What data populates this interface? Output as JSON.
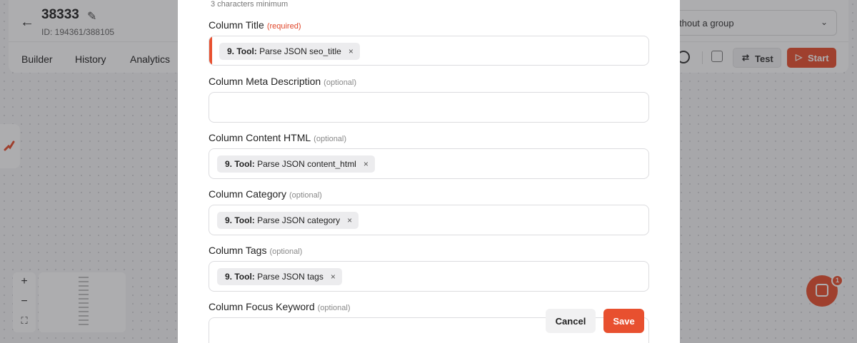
{
  "app": {
    "workflow_title": "38333",
    "workflow_id": "ID: 194361/388105",
    "tabs": [
      "Builder",
      "History",
      "Analytics"
    ],
    "group_select_value": "thout a group",
    "test_label": "Test",
    "start_label": "Start",
    "zoom_in": "+",
    "zoom_out": "−",
    "fit": "⛶",
    "chat_badge": "1"
  },
  "modal": {
    "hint": "3 characters minimum",
    "fields": [
      {
        "label": "Column Title",
        "tag": "(required)",
        "chip_prefix": "9. Tool:",
        "chip_text": "Parse JSON seo_title"
      },
      {
        "label": "Column Meta Description",
        "tag": "(optional)"
      },
      {
        "label": "Column Content HTML",
        "tag": "(optional)",
        "chip_prefix": "9. Tool:",
        "chip_text": "Parse JSON content_html"
      },
      {
        "label": "Column Category",
        "tag": "(optional)",
        "chip_prefix": "9. Tool:",
        "chip_text": "Parse JSON category"
      },
      {
        "label": "Column Tags",
        "tag": "(optional)",
        "chip_prefix": "9. Tool:",
        "chip_text": "Parse JSON tags"
      },
      {
        "label": "Column Focus Keyword",
        "tag": "(optional)"
      }
    ],
    "remove_glyph": "×",
    "cancel_label": "Cancel",
    "save_label": "Save"
  },
  "colors": {
    "accent": "#e8502f",
    "required": "#e0462a"
  }
}
